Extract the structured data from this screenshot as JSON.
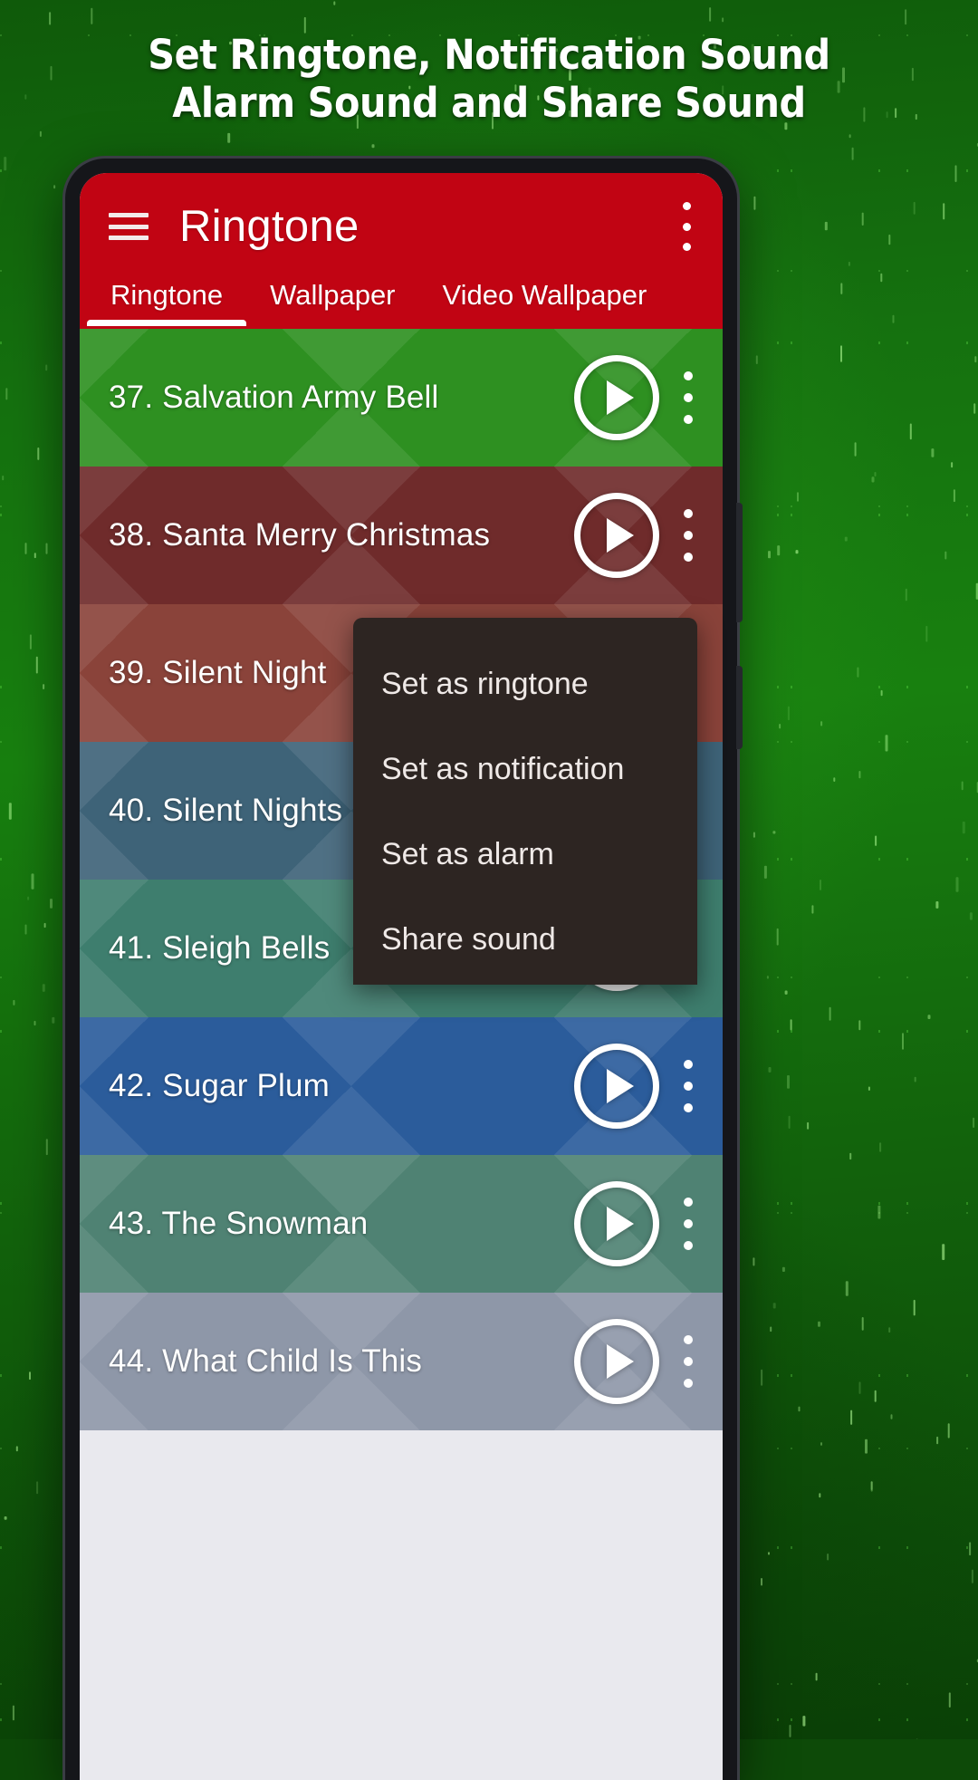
{
  "promo": {
    "headline_line1": "Set Ringtone, Notification Sound",
    "headline_line2": "Alarm Sound and Share Sound",
    "background_color": "#146c0e"
  },
  "appbar": {
    "title": "Ringtone",
    "color": "#c10413",
    "menu_icon": "hamburger-icon",
    "overflow_icon": "overflow-menu-icon"
  },
  "tabs": [
    {
      "label": "Ringtone",
      "active": true
    },
    {
      "label": "Wallpaper",
      "active": false
    },
    {
      "label": "Video Wallpaper",
      "active": false
    }
  ],
  "list": {
    "play_icon": "play-icon",
    "overflow_icon": "overflow-menu-icon",
    "rows": [
      {
        "label": "37. Salvation Army Bell",
        "color": "#2e9021"
      },
      {
        "label": "38. Santa Merry Christmas",
        "color": "#6f2b2b"
      },
      {
        "label": "39. Silent Night",
        "color": "#8a433a"
      },
      {
        "label": "40. Silent Nights",
        "color": "#3e6378"
      },
      {
        "label": "41. Sleigh Bells",
        "color": "#3e7e6e"
      },
      {
        "label": "42. Sugar Plum",
        "color": "#2b5c9b"
      },
      {
        "label": "43. The Snowman",
        "color": "#4f8273"
      },
      {
        "label": "44. What Child Is This",
        "color": "#8e97a8"
      }
    ]
  },
  "popup_menu": {
    "background_color": "#2d2522",
    "items": [
      {
        "label": "Set as ringtone"
      },
      {
        "label": "Set as notification"
      },
      {
        "label": "Set as alarm"
      },
      {
        "label": "Share sound"
      }
    ]
  }
}
